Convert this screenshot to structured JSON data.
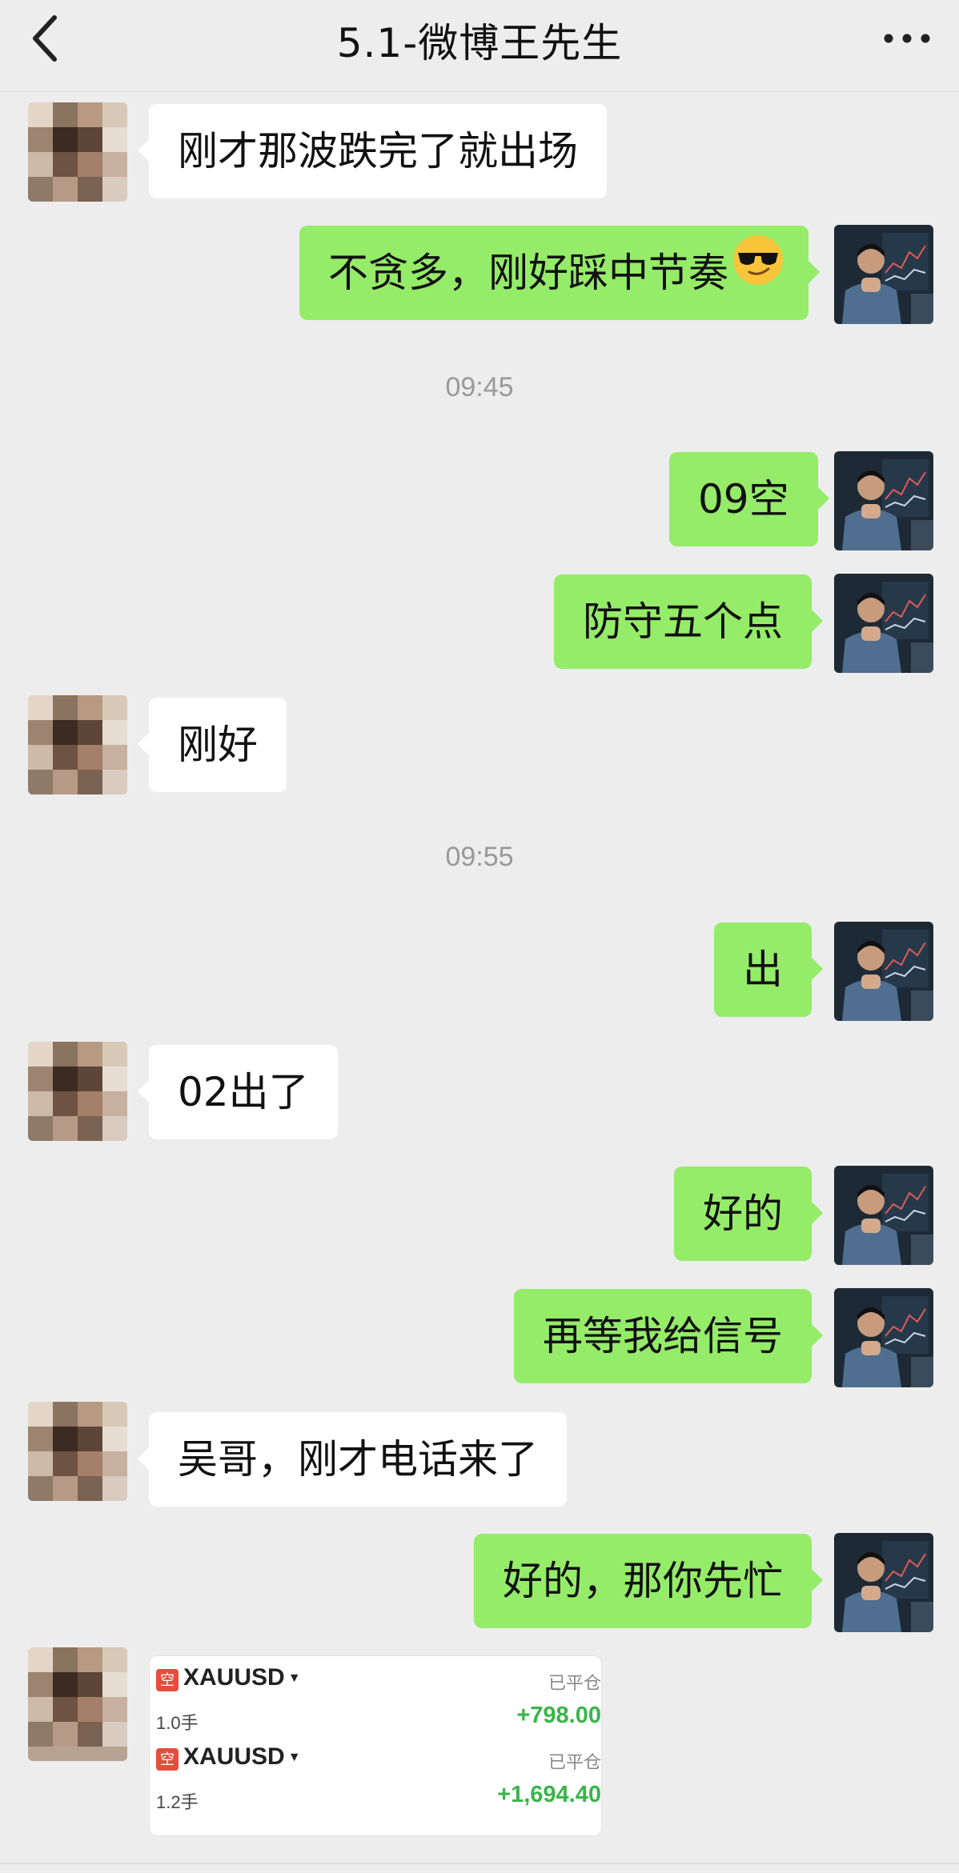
{
  "header": {
    "title": "5.1-微博王先生",
    "back_icon": "chevron-left-icon",
    "more_icon": "more-dots-icon"
  },
  "colors": {
    "outgoing_bubble": "#95ec69",
    "incoming_bubble": "#ffffff",
    "background": "#ededed",
    "profit": "#39b54a",
    "short_badge": "#e74c3c"
  },
  "messages": [
    {
      "side": "in",
      "text": "刚才那波跌完了就出场"
    },
    {
      "side": "out",
      "text": "不贪多，刚好踩中节奏",
      "emoji": "smirk-sunglasses-emoji"
    },
    {
      "time": "09:45"
    },
    {
      "side": "out",
      "text": "09空"
    },
    {
      "side": "out",
      "text": "防守五个点"
    },
    {
      "side": "in",
      "text": "刚好"
    },
    {
      "time": "09:55"
    },
    {
      "side": "out",
      "text": "出"
    },
    {
      "side": "in",
      "text": "02出了"
    },
    {
      "side": "out",
      "text": "好的"
    },
    {
      "side": "out",
      "text": "再等我给信号"
    },
    {
      "side": "in",
      "text": "吴哥，刚才电话来了"
    },
    {
      "side": "out",
      "text": "好的，那你先忙"
    }
  ],
  "trade_card": {
    "trades": [
      {
        "badge": "空",
        "symbol": "XAUUSD",
        "status": "已平仓",
        "lots": "1.0手",
        "profit": "+798.00"
      },
      {
        "badge": "空",
        "symbol": "XAUUSD",
        "status": "已平仓",
        "lots": "1.2手",
        "profit": "+1,694.40"
      }
    ]
  }
}
